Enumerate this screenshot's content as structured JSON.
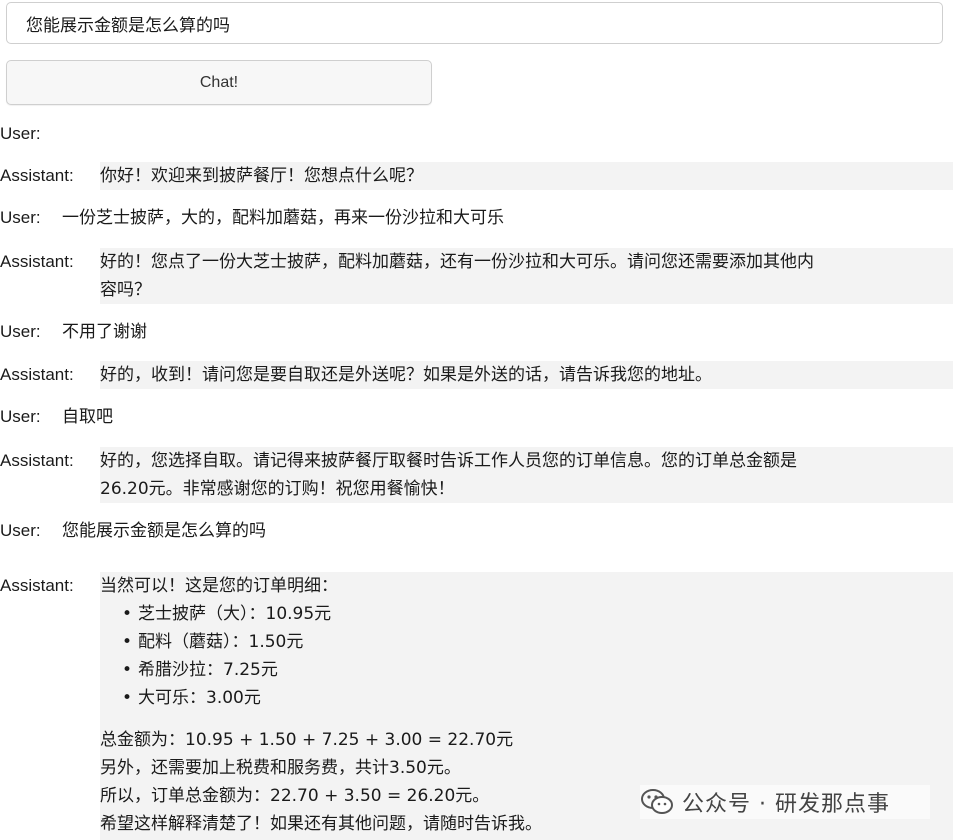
{
  "input": {
    "value": "您能展示金额是怎么算的吗"
  },
  "chat_button": {
    "label": "Chat!"
  },
  "messages": [
    {
      "speaker": "User:",
      "lines": [
        ""
      ]
    },
    {
      "speaker": "Assistant:",
      "lines": [
        "你好！欢迎来到披萨餐厅！您想点什么呢？"
      ]
    },
    {
      "speaker": "User:",
      "lines": [
        "一份芝士披萨，大的，配料加蘑菇，再来一份沙拉和大可乐"
      ]
    },
    {
      "speaker": "Assistant:",
      "lines": [
        "好的！您点了一份大芝士披萨，配料加蘑菇，还有一份沙拉和大可乐。请问您还需要添加其他内",
        "容吗？"
      ]
    },
    {
      "speaker": "User:",
      "lines": [
        "不用了谢谢"
      ]
    },
    {
      "speaker": "Assistant:",
      "lines": [
        "好的，收到！请问您是要自取还是外送呢？如果是外送的话，请告诉我您的地址。"
      ]
    },
    {
      "speaker": "User:",
      "lines": [
        "自取吧"
      ]
    },
    {
      "speaker": "Assistant:",
      "lines": [
        "好的，您选择自取。请记得来披萨餐厅取餐时告诉工作人员您的订单信息。您的订单总金额是",
        "26.20元。非常感谢您的订购！祝您用餐愉快！"
      ]
    },
    {
      "speaker": "User:",
      "lines": [
        "您能展示金额是怎么算的吗"
      ]
    },
    {
      "speaker": "Assistant:",
      "intro": "当然可以！这是您的订单明细：",
      "items": [
        "芝士披萨（大）：10.95元",
        "配料（蘑菇）：1.50元",
        "希腊沙拉：7.25元",
        "大可乐：3.00元"
      ],
      "summary": [
        "总金额为：10.95 + 1.50 + 7.25 + 3.00 = 22.70元",
        "另外，还需要加上税费和服务费，共计3.50元。",
        "所以，订单总金额为：22.70 + 3.50 = 26.20元。",
        "希望这样解释清楚了！如果还有其他问题，请随时告诉我。"
      ]
    }
  ],
  "watermark": {
    "text": "公众号 · 研发那点事",
    "icon": "wechat-icon",
    "color": "#444444"
  },
  "colors": {
    "assistant_bg": "#f3f3f3",
    "border": "#cfcfcf"
  }
}
